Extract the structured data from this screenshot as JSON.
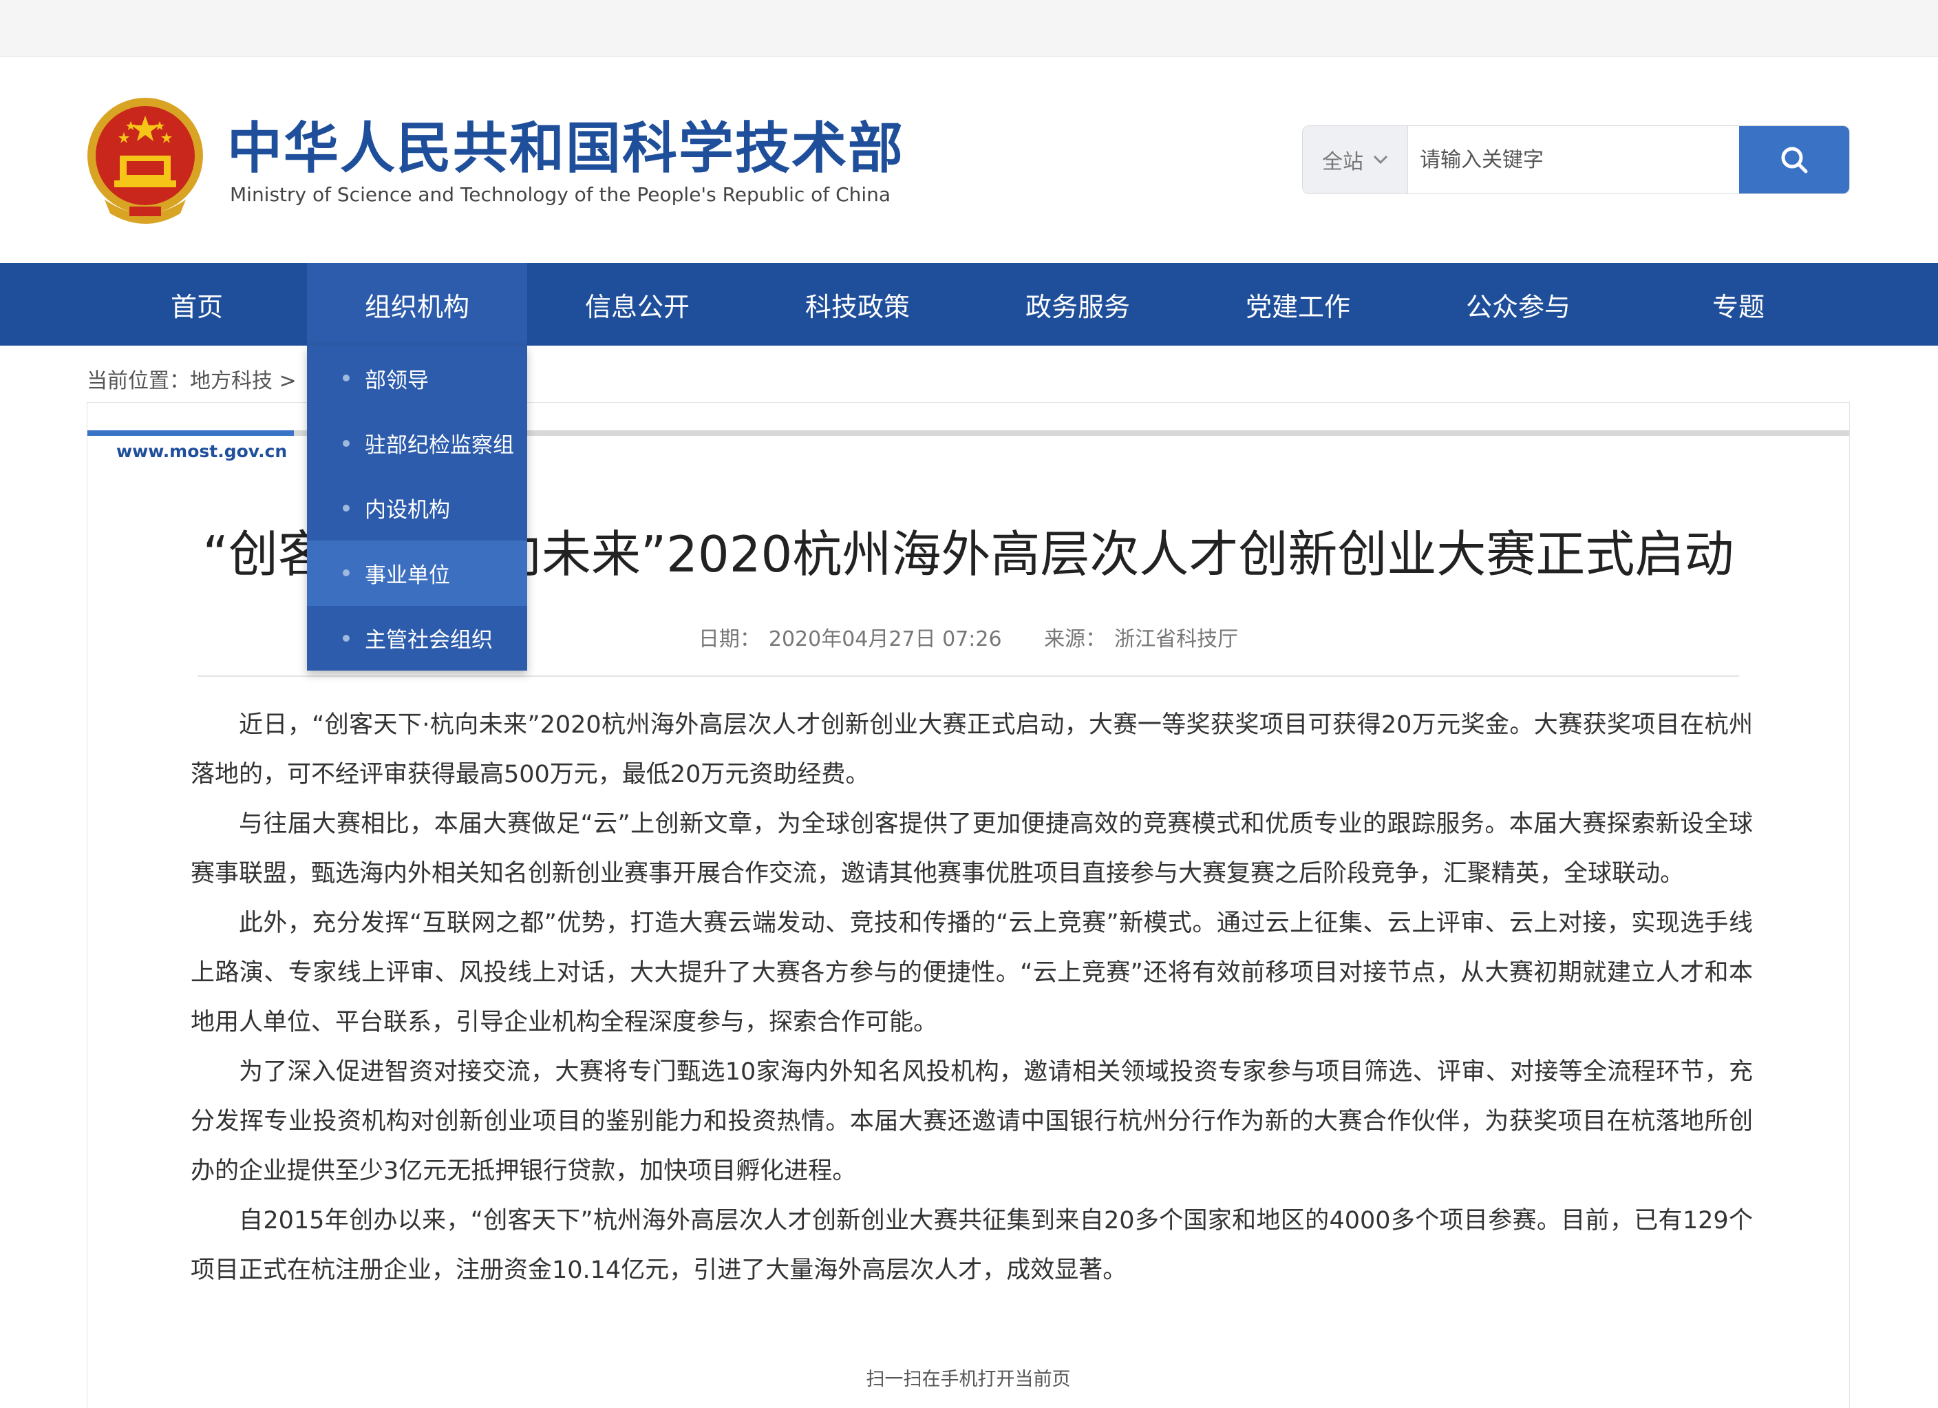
{
  "header": {
    "title": "中华人民共和国科学技术部",
    "subtitle": "Ministry of Science and Technology of the People's Republic of China"
  },
  "search": {
    "scope": "全站",
    "placeholder": "请输入关键字"
  },
  "nav": {
    "items": [
      "首页",
      "组织机构",
      "信息公开",
      "科技政策",
      "政务服务",
      "党建工作",
      "公众参与",
      "专题"
    ],
    "active": "组织机构"
  },
  "dropdown": {
    "items": [
      "部领导",
      "驻部纪检监察组",
      "内设机构",
      "事业单位",
      "主管社会组织"
    ],
    "hovered": "事业单位"
  },
  "breadcrumb": "当前位置：地方科技 >",
  "frame": {
    "site": "www.most.gov.cn"
  },
  "article": {
    "title": "“创客天下·杭向未来”2020杭州海外高层次人才创新创业大赛正式启动",
    "date_label": "日期：",
    "date": "2020年04月27日 07:26",
    "source_label": "来源：",
    "source": "浙江省科技厅",
    "paragraphs": [
      "近日，“创客天下·杭向未来”2020杭州海外高层次人才创新创业大赛正式启动，大赛一等奖获奖项目可获得20万元奖金。大赛获奖项目在杭州落地的，可不经评审获得最高500万元，最低20万元资助经费。",
      "与往届大赛相比，本届大赛做足“云”上创新文章，为全球创客提供了更加便捷高效的竞赛模式和优质专业的跟踪服务。本届大赛探索新设全球赛事联盟，甄选海内外相关知名创新创业赛事开展合作交流，邀请其他赛事优胜项目直接参与大赛复赛之后阶段竞争，汇聚精英，全球联动。",
      "此外，充分发挥“互联网之都”优势，打造大赛云端发动、竞技和传播的“云上竞赛”新模式。通过云上征集、云上评审、云上对接，实现选手线上路演、专家线上评审、风投线上对话，大大提升了大赛各方参与的便捷性。“云上竞赛”还将有效前移项目对接节点，从大赛初期就建立人才和本地用人单位、平台联系，引导企业机构全程深度参与，探索合作可能。",
      "为了深入促进智资对接交流，大赛将专门甄选10家海内外知名风投机构，邀请相关领域投资专家参与项目筛选、评审、对接等全流程环节，充分发挥专业投资机构对创新创业项目的鉴别能力和投资热情。本届大赛还邀请中国银行杭州分行作为新的大赛合作伙伴，为获奖项目在杭落地所创办的企业提供至少3亿元无抵押银行贷款，加快项目孵化进程。",
      "自2015年创办以来，“创客天下”杭州海外高层次人才创新创业大赛共征集到来自20多个国家和地区的4000多个项目参赛。目前，已有129个项目正式在杭注册企业，注册资金10.14亿元，引进了大量海外高层次人才，成效显著。"
    ],
    "qr_note": "扫一扫在手机打开当前页"
  },
  "colors": {
    "nav_bg": "#1f4f9b",
    "nav_active": "#2c5cab",
    "accent": "#3a73c6",
    "title_blue": "#1f4f9b"
  },
  "icons": {
    "emblem": "national-emblem-icon",
    "scope": "chevron-down-icon",
    "search": "search-icon"
  }
}
